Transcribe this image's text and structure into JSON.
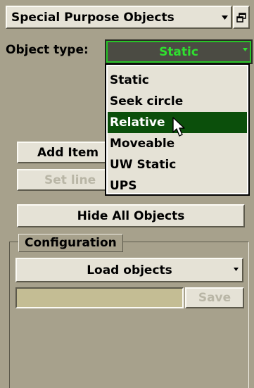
{
  "header": {
    "title": "Special Purpose Objects",
    "dropdown_icon": "triangle-down-icon",
    "restore_icon": "restore-window-icon"
  },
  "object_type": {
    "label": "Object type:",
    "selected": "Static",
    "options": [
      "Static",
      "Seek circle",
      "Relative",
      "Moveable",
      "UW Static",
      "UPS"
    ],
    "highlighted": "Relative"
  },
  "actions": {
    "add_item": "Add Item",
    "set_line": "Set line",
    "hide_all": "Hide All Objects"
  },
  "configuration": {
    "title": "Configuration",
    "load_objects": "Load objects",
    "save": "Save",
    "name_value": ""
  },
  "colors": {
    "panel_bg": "#a7a18c",
    "button_face": "#e5e2d6",
    "select_text": "#2fe02f",
    "highlight_bg": "#0b4f0b",
    "field_bg": "#c4bd94"
  }
}
